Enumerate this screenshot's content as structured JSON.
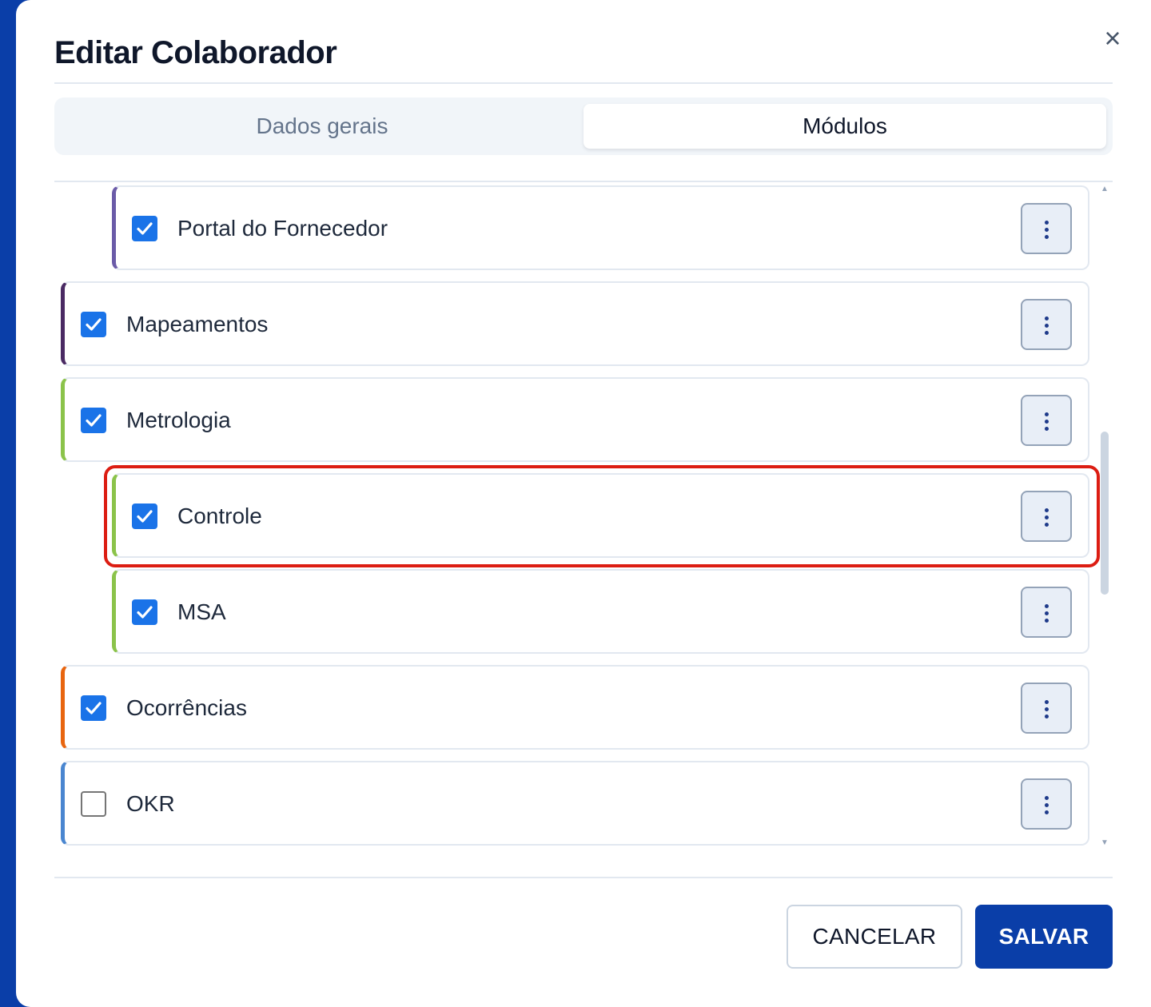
{
  "dialog": {
    "title": "Editar Colaborador",
    "close_icon": "close-icon"
  },
  "tabs": [
    {
      "label": "Dados gerais",
      "active": false
    },
    {
      "label": "Módulos",
      "active": true
    }
  ],
  "modules": [
    {
      "label": "Portal do Fornecedor",
      "checked": true,
      "level": 2,
      "accent": "#6b5ba8"
    },
    {
      "label": "Mapeamentos",
      "checked": true,
      "level": 1,
      "accent": "#4a2a63"
    },
    {
      "label": "Metrologia",
      "checked": true,
      "level": 1,
      "accent": "#8bc34a"
    },
    {
      "label": "Controle",
      "checked": true,
      "level": 2,
      "accent": "#8bc34a",
      "highlighted": true
    },
    {
      "label": "MSA",
      "checked": true,
      "level": 2,
      "accent": "#8bc34a"
    },
    {
      "label": "Ocorrências",
      "checked": true,
      "level": 1,
      "accent": "#e8650f"
    },
    {
      "label": "OKR",
      "checked": false,
      "level": 1,
      "accent": "#4a86d0"
    }
  ],
  "footer": {
    "cancel_label": "CANCELAR",
    "save_label": "SALVAR"
  },
  "colors": {
    "primary": "#0a3ea8",
    "checkbox": "#1a73e8",
    "highlight": "#dc1d12"
  }
}
